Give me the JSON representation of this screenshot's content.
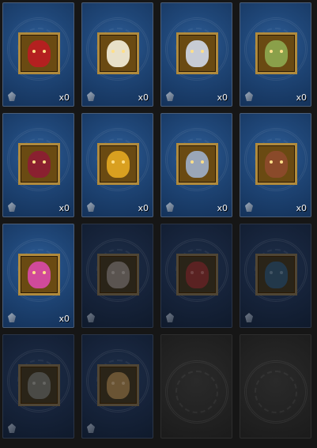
{
  "collection": {
    "slots": [
      {
        "state": "bright",
        "count": "x0",
        "icon": "red-armored-demon-portrait-icon",
        "accent": "#b42020"
      },
      {
        "state": "bright",
        "count": "x0",
        "icon": "white-bearded-sage-portrait-icon",
        "accent": "#e8e0c8"
      },
      {
        "state": "bright",
        "count": "x0",
        "icon": "silver-hooded-mage-portrait-icon",
        "accent": "#c7cbd4"
      },
      {
        "state": "bright",
        "count": "x0",
        "icon": "golden-crowned-golem-portrait-icon",
        "accent": "#8aa04a"
      },
      {
        "state": "bright",
        "count": "x0",
        "icon": "crimson-horned-knight-portrait-icon",
        "accent": "#8a2030"
      },
      {
        "state": "bright",
        "count": "x0",
        "icon": "masked-gold-warrior-portrait-icon",
        "accent": "#d9a020"
      },
      {
        "state": "bright",
        "count": "x0",
        "icon": "silver-haired-dark-elf-portrait-icon",
        "accent": "#9aa6b8"
      },
      {
        "state": "bright",
        "count": "x0",
        "icon": "bronze-tribal-mask-portrait-icon",
        "accent": "#8a4a2a"
      },
      {
        "state": "bright",
        "count": "x0",
        "icon": "pink-winged-witch-portrait-icon",
        "accent": "#d04a9a"
      },
      {
        "state": "dim",
        "count": "",
        "icon": "white-haired-girl-portrait-icon",
        "accent": "#5a5450"
      },
      {
        "state": "dim",
        "count": "",
        "icon": "red-imp-portrait-icon",
        "accent": "#5a2222"
      },
      {
        "state": "dim",
        "count": "",
        "icon": "blue-beast-portrait-icon",
        "accent": "#22384a"
      },
      {
        "state": "dim",
        "count": "",
        "icon": "grey-ghoul-portrait-icon",
        "accent": "#4a4a46"
      },
      {
        "state": "dim",
        "count": "",
        "icon": "bronze-mask-portrait-icon",
        "accent": "#6a5434"
      },
      {
        "state": "empty",
        "count": "",
        "icon": "",
        "accent": ""
      },
      {
        "state": "empty",
        "count": "",
        "icon": "",
        "accent": ""
      }
    ]
  }
}
